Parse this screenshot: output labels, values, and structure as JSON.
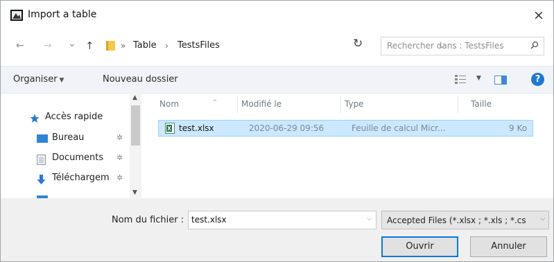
{
  "window": {
    "title": "Import a table",
    "close_label": "×"
  },
  "nav": {
    "back": "←",
    "forward": "→",
    "recent": "⌄",
    "up": "↑"
  },
  "address": {
    "separator": "»",
    "crumbs": [
      "Table",
      "TestsFiles"
    ],
    "crumb_separator": "›"
  },
  "search": {
    "placeholder": "Rechercher dans : TestsFiles",
    "value": ""
  },
  "toolbar": {
    "organize": "Organiser",
    "new_folder": "Nouveau dossier",
    "help": "?"
  },
  "sidebar": {
    "items": [
      {
        "label": "Accès rapide",
        "icon": "star-icon"
      },
      {
        "label": "Bureau",
        "icon": "desktop-icon",
        "pinned": true
      },
      {
        "label": "Documents",
        "icon": "documents-icon",
        "pinned": true
      },
      {
        "label": "Téléchargem",
        "icon": "download-icon",
        "pinned": true
      }
    ]
  },
  "columns": [
    "Nom",
    "Modifié le",
    "Type",
    "Taille"
  ],
  "files": [
    {
      "name": "test.xlsx",
      "modified": "2020-06-29 09:56",
      "type": "Feuille de calcul Micr...",
      "size": "9 Ko",
      "selected": true
    }
  ],
  "footer": {
    "filename_label": "Nom du fichier :",
    "filename_value": "test.xlsx",
    "filter": "Accepted Files (*.xlsx ; *.xls ; *.cs",
    "open": "Ouvrir",
    "cancel": "Annuler"
  },
  "colors": {
    "accent": "#0a78d7",
    "selection": "#cce8ff",
    "selection_border": "#99d1ff",
    "toolbar_bg": "#f0f3f7",
    "footer_bg": "#f0f0f0"
  }
}
